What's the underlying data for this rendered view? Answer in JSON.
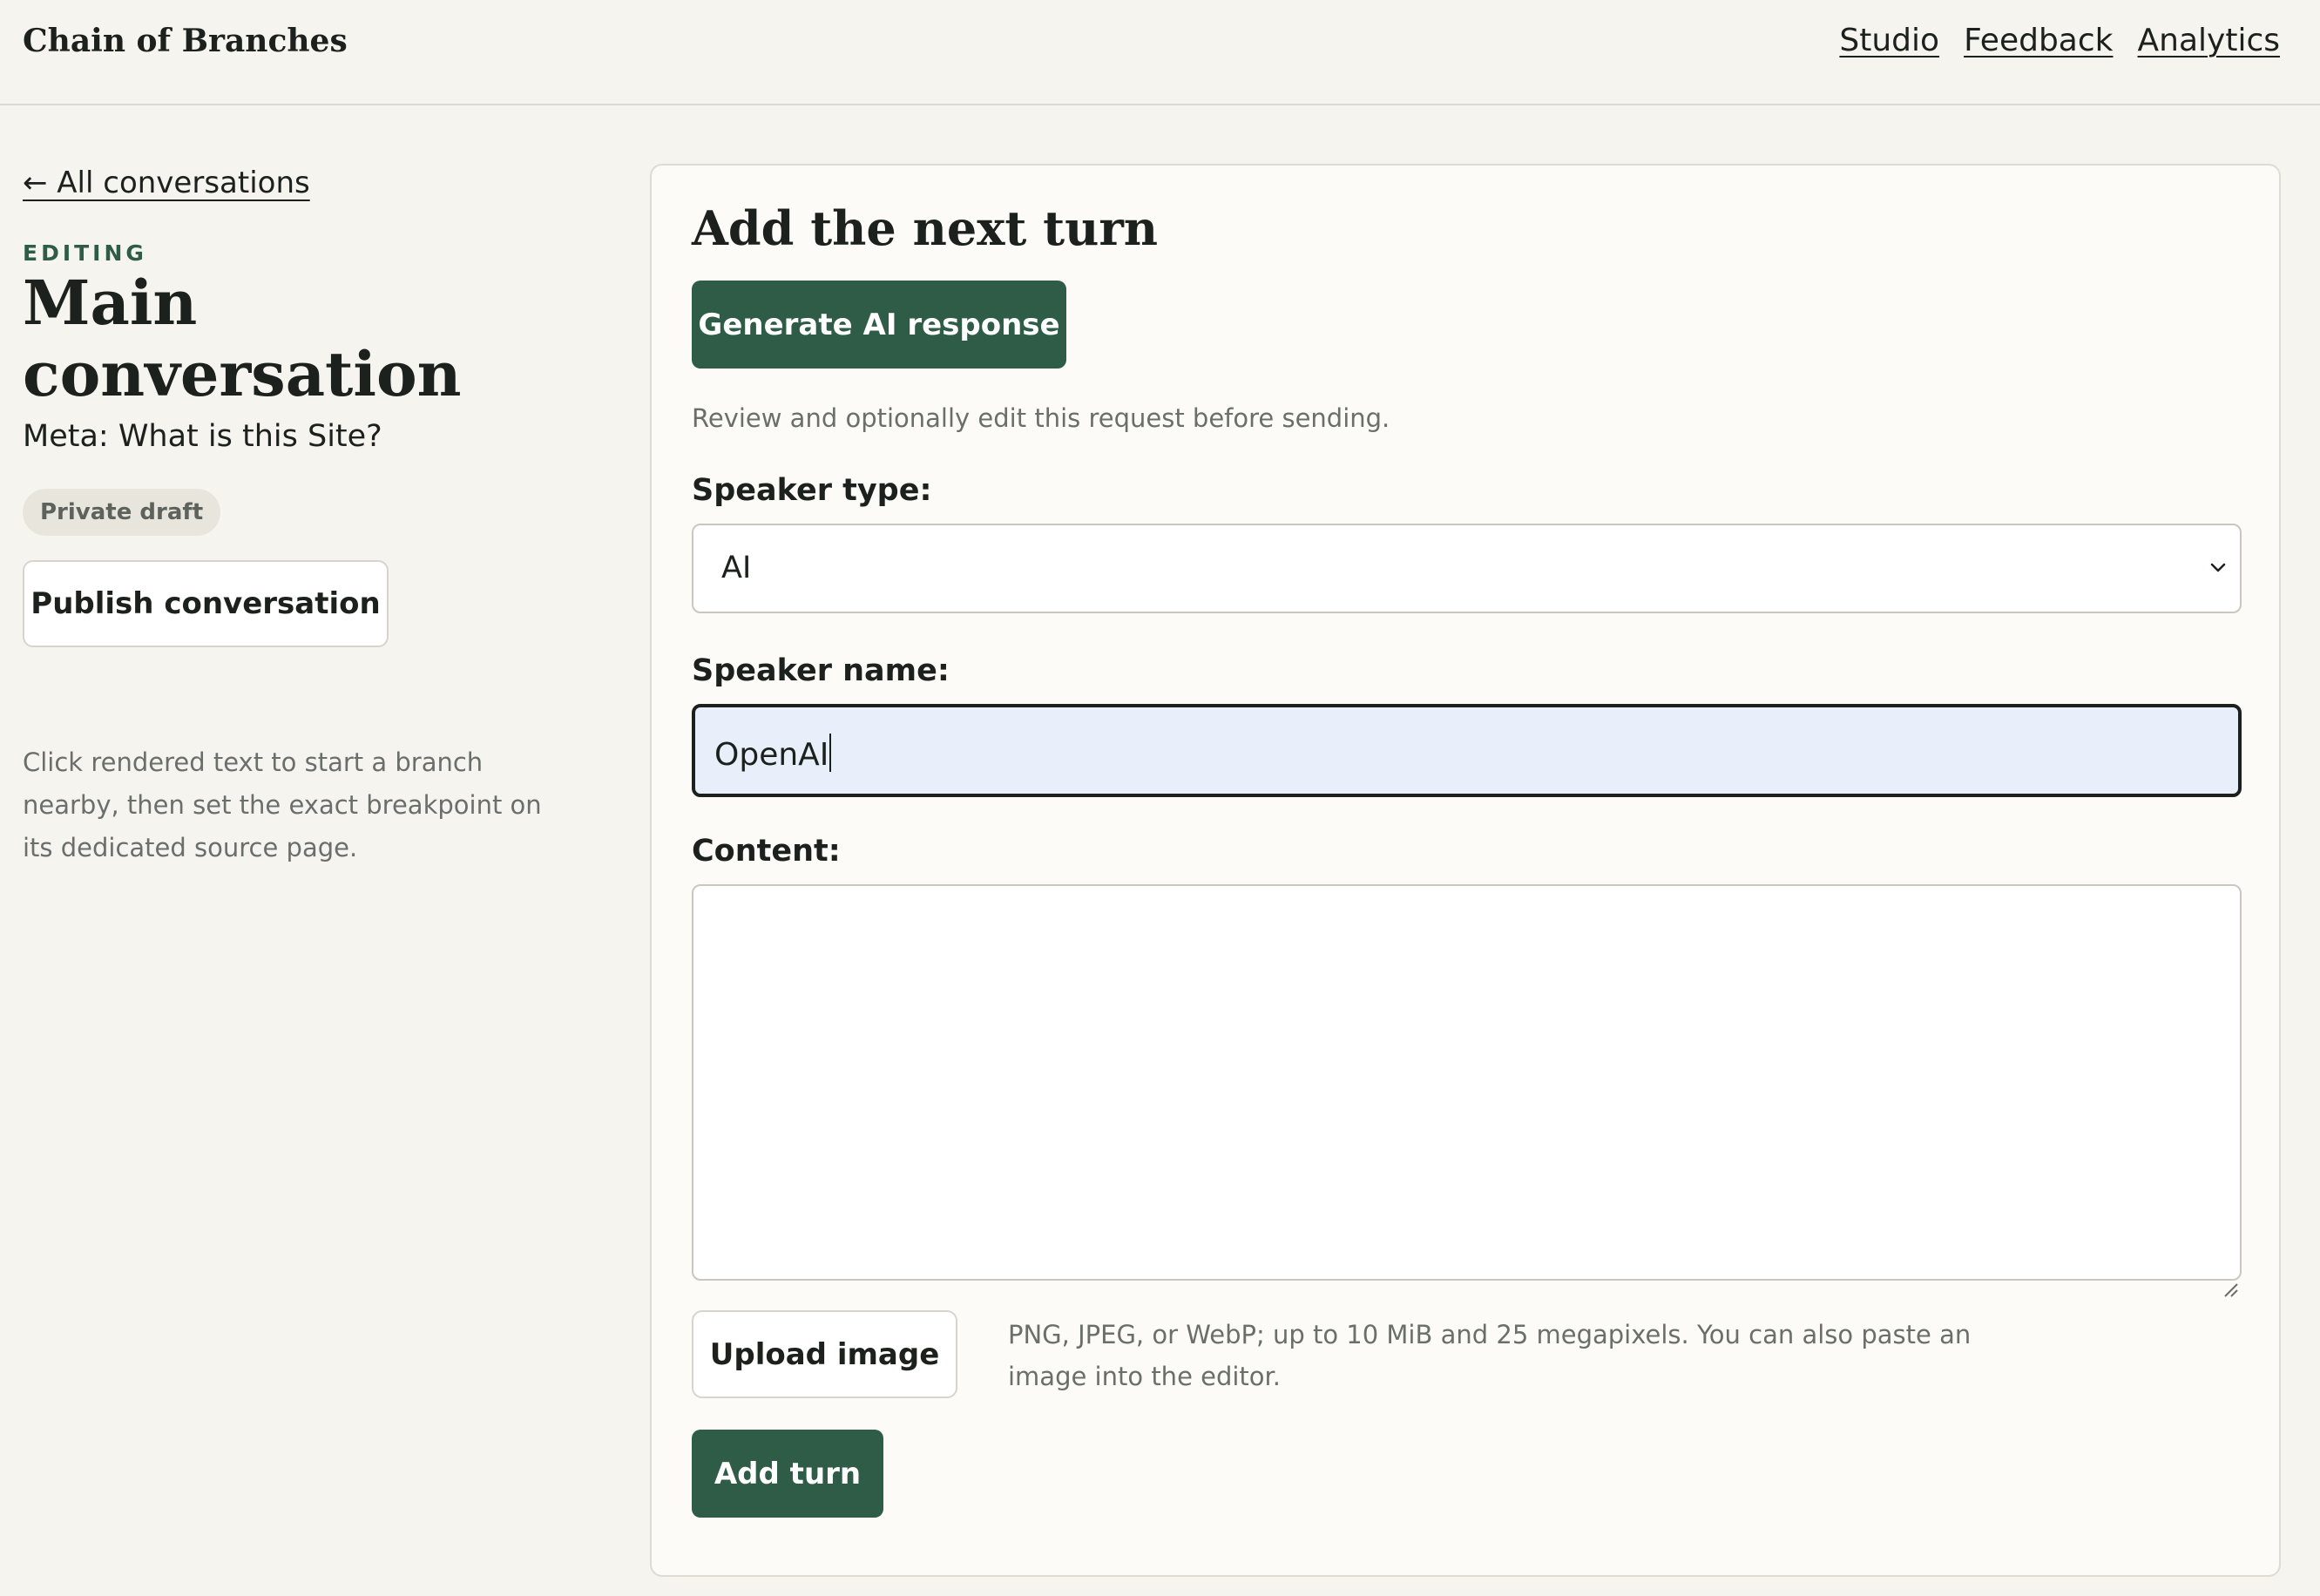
{
  "header": {
    "site_title": "Chain of Branches",
    "nav": [
      "Studio",
      "Feedback",
      "Analytics"
    ]
  },
  "sidebar": {
    "back_link": "← All conversations",
    "editing_label": "EDITING",
    "title": "Main conversation",
    "subtitle": "Meta: What is this Site?",
    "status_badge": "Private draft",
    "publish_button": "Publish conversation",
    "help_text": "Click rendered text to start a branch nearby, then set the exact breakpoint on its dedicated source page."
  },
  "main": {
    "heading": "Add the next turn",
    "generate_button": "Generate AI response",
    "review_note": "Review and optionally edit this request before sending.",
    "speaker_type_label": "Speaker type:",
    "speaker_type_value": "AI",
    "speaker_name_label": "Speaker name:",
    "speaker_name_value": "OpenAI",
    "content_label": "Content:",
    "content_value": "",
    "upload_button": "Upload image",
    "upload_help": "PNG, JPEG, or WebP; up to 10 MiB and 25 megapixels. You can also paste an image into the editor.",
    "add_turn_button": "Add turn"
  },
  "colors": {
    "page_background": "#f6f4ee",
    "card_background": "#fcfbf7",
    "primary_button": "#2f5c47",
    "editing_label": "#2f5c47",
    "focused_input_background": "#e8effb",
    "badge_background": "#e7e5dc"
  },
  "icons": {
    "select_indicator": "chevron-down-icon",
    "textarea_resize": "resize-handle-icon"
  }
}
